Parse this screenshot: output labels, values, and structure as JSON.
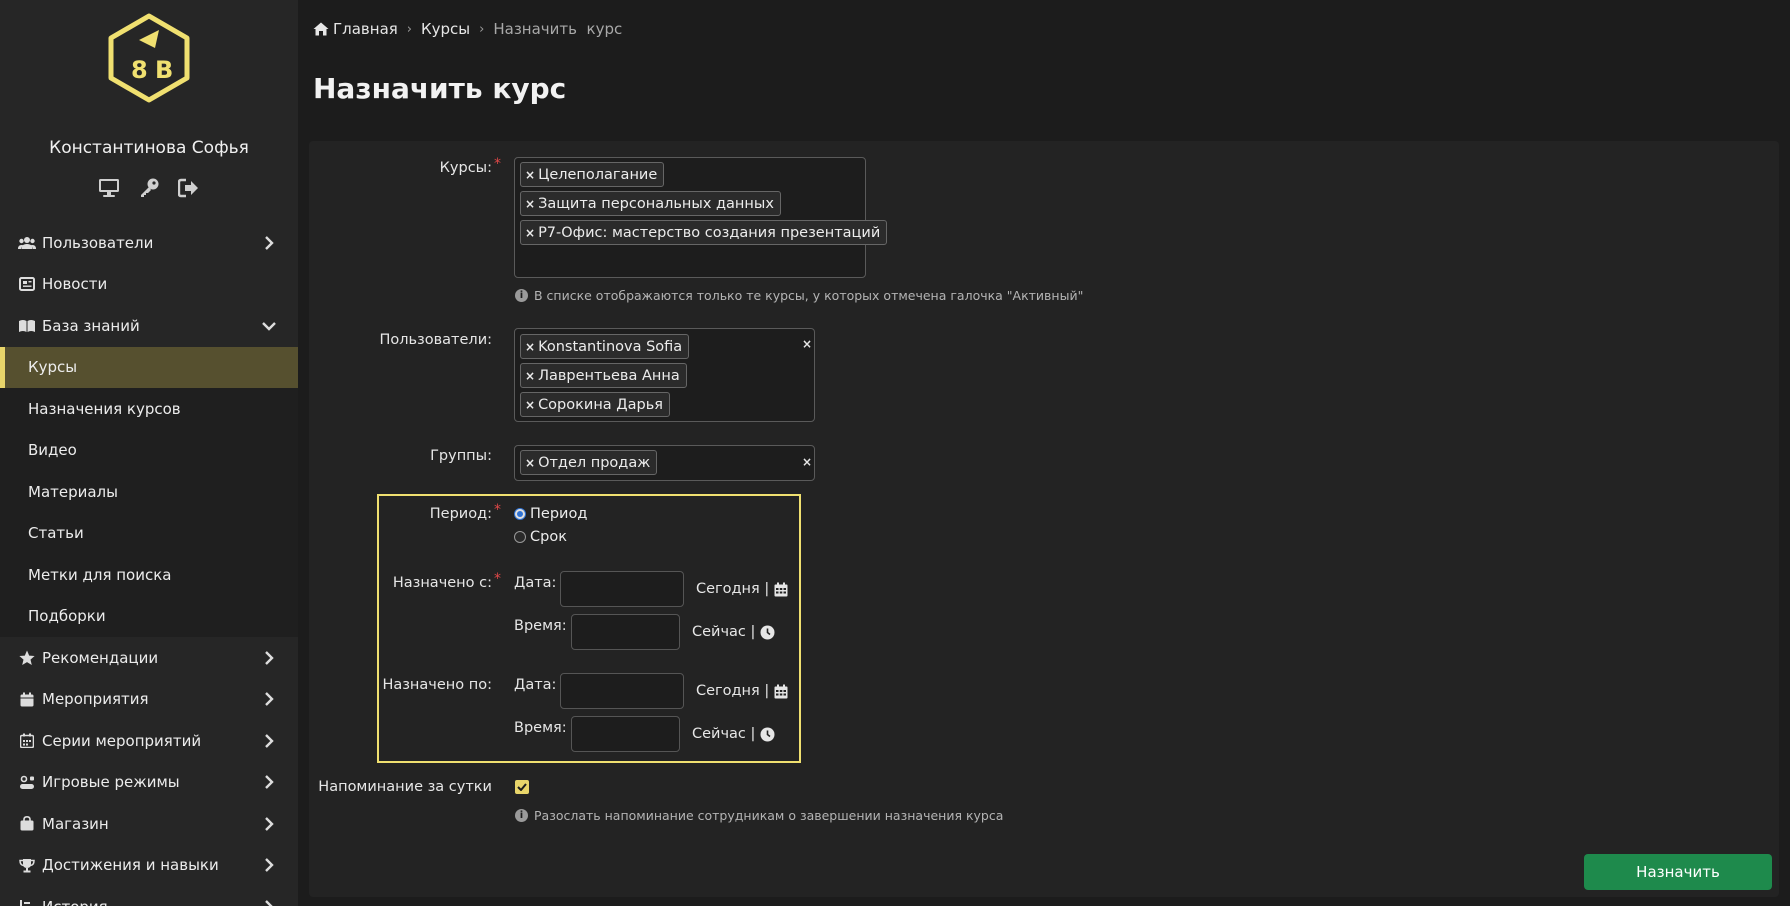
{
  "user": {
    "name": "Константинова Софья"
  },
  "user_icons": [
    "monitor-icon",
    "key-icon",
    "logout-icon"
  ],
  "sidebar": {
    "items": [
      {
        "label": "Пользователи",
        "icon": "users-icon"
      },
      {
        "label": "Новости",
        "icon": "newspaper-icon"
      },
      {
        "label": "База знаний",
        "icon": "book-icon",
        "expanded": true
      },
      {
        "label": "Рекомендации",
        "icon": "star-icon"
      },
      {
        "label": "Мероприятия",
        "icon": "calendar-icon"
      },
      {
        "label": "Серии мероприятий",
        "icon": "calendar-grid-icon"
      },
      {
        "label": "Игровые режимы",
        "icon": "game-icon"
      },
      {
        "label": "Магазин",
        "icon": "shopping-bag-icon"
      },
      {
        "label": "Достижения и навыки",
        "icon": "trophy-icon"
      },
      {
        "label": "История",
        "icon": "history-icon"
      }
    ],
    "submenu": [
      {
        "label": "Курсы",
        "active": true
      },
      {
        "label": "Назначения курсов"
      },
      {
        "label": "Видео"
      },
      {
        "label": "Материалы"
      },
      {
        "label": "Статьи"
      },
      {
        "label": "Метки для поиска"
      },
      {
        "label": "Подборки"
      }
    ]
  },
  "breadcrumb": {
    "home": "Главная",
    "courses": "Курсы",
    "current": "Назначить  курс"
  },
  "page_title": "Назначить курс",
  "form": {
    "courses": {
      "label": "Курсы:",
      "tags": [
        "Целеполагание",
        "Защита персональных данных",
        "Р7-Офис: мастерство создания презентаций"
      ],
      "hint": "В списке отображаются только те курсы, у которых отмечена галочка \"Активный\""
    },
    "users": {
      "label": "Пользователи:",
      "tags": [
        "Konstantinova Sofia",
        "Лаврентьева Анна",
        "Сорокина Дарья"
      ]
    },
    "groups": {
      "label": "Группы:",
      "tags": [
        "Отдел продаж"
      ]
    },
    "period": {
      "label": "Период:",
      "options": [
        {
          "label": "Период",
          "checked": true
        },
        {
          "label": "Срок",
          "checked": false
        }
      ]
    },
    "assigned_from": {
      "label": "Назначено с:",
      "date_label": "Дата:",
      "time_label": "Время:",
      "date_value": "",
      "time_value": "",
      "today_link": "Сегодня |",
      "now_link": "Сейчас |"
    },
    "assigned_to": {
      "label": "Назначено по:",
      "date_label": "Дата:",
      "time_label": "Время:",
      "date_value": "",
      "time_value": "",
      "today_link": "Сегодня |",
      "now_link": "Сейчас |"
    },
    "reminder": {
      "label": "Напоминание за сутки",
      "checked": true,
      "hint": "Разослать напоминание сотрудникам о завершении назначения курса"
    },
    "submit_label": "Назначить"
  },
  "colors": {
    "accent": "#e8d56a",
    "submit": "#1e8a4c",
    "required": "#e04848",
    "active_menu": "#56502f"
  }
}
